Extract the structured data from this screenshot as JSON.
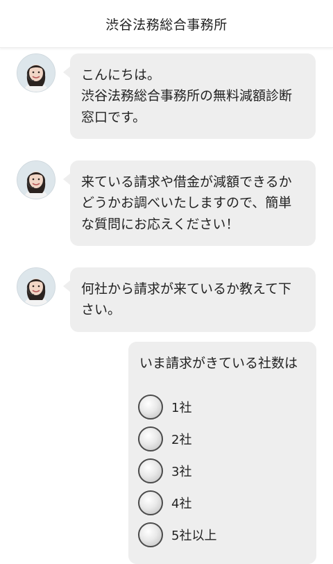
{
  "header": {
    "title": "渋谷法務総合事務所"
  },
  "messages": [
    {
      "lines": [
        "こんにちは。",
        "渋谷法務総合事務所の無料減額診断",
        "窓口です。"
      ]
    },
    {
      "lines": [
        "来ている請求や借金が減額できるか",
        "どうかお調べいたしますので、簡単",
        "な質問にお応えください！"
      ]
    },
    {
      "lines": [
        "何社から請求が来ているか教えて下",
        "さい。"
      ]
    }
  ],
  "quiz": {
    "question": "いま請求がきている社数は",
    "options": [
      {
        "label": "1社"
      },
      {
        "label": "2社"
      },
      {
        "label": "3社"
      },
      {
        "label": "4社"
      },
      {
        "label": "5社以上"
      }
    ]
  },
  "colors": {
    "bubble": "#eeeeee",
    "header_bg": "#ffffff",
    "text": "#222222",
    "radio_border": "#4a4a4a"
  },
  "icons": {
    "avatar": "operator-avatar"
  }
}
